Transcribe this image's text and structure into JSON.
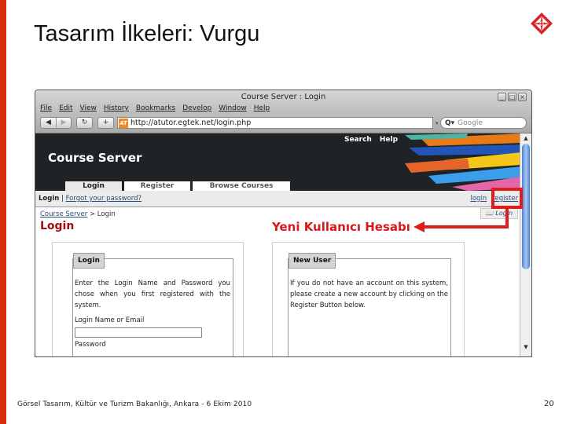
{
  "slide": {
    "title": "Tasarım İlkeleri: Vurgu",
    "footer": "Görsel Tasarım, Kültür ve Turizm Bakanlığı, Ankara - 6 Ekim 2010",
    "page_number": "20",
    "accent_color": "#d92e0e",
    "logo_icon": "compass-star-icon"
  },
  "browser": {
    "window_title": "Course Server : Login",
    "window_controls": [
      "_",
      "□",
      "×"
    ],
    "menu": [
      "File",
      "Edit",
      "View",
      "History",
      "Bookmarks",
      "Develop",
      "Window",
      "Help"
    ],
    "nav_buttons": {
      "back": "◀",
      "forward": "▶",
      "reload": "↻",
      "new_tab": "+"
    },
    "favicon_text": "AT",
    "url": "http://atutor.egtek.net/login.php",
    "search_placeholder": "Google",
    "search_glyph": "Q▾"
  },
  "site": {
    "name": "Course Server",
    "top_links": [
      "Search",
      "Help"
    ],
    "tabs": [
      {
        "label": "Login",
        "active": true
      },
      {
        "label": "Register",
        "active": false
      },
      {
        "label": "Browse Courses",
        "active": false
      }
    ],
    "subnav": {
      "current": "Login",
      "separator": "|",
      "forgot_link": "Forgot your password?",
      "login_link": "login",
      "register_link": "register"
    },
    "breadcrumb": {
      "root": "Course Server",
      "separator": ">",
      "current": "Login"
    },
    "heading": "Login",
    "mini_login": "Login",
    "login_box": {
      "legend": "Login",
      "text": "Enter the Login Name and Password you chose when you first registered with the system.",
      "username_label": "Login Name or Email",
      "username_value": "",
      "password_label": "Password"
    },
    "new_user_box": {
      "legend": "New User",
      "text": "If you do not have an account on this system, please create a new account by clicking on the Register Button below."
    }
  },
  "annotation": {
    "label": "Yeni Kullanıcı Hesabı",
    "color": "#e11a1a"
  }
}
